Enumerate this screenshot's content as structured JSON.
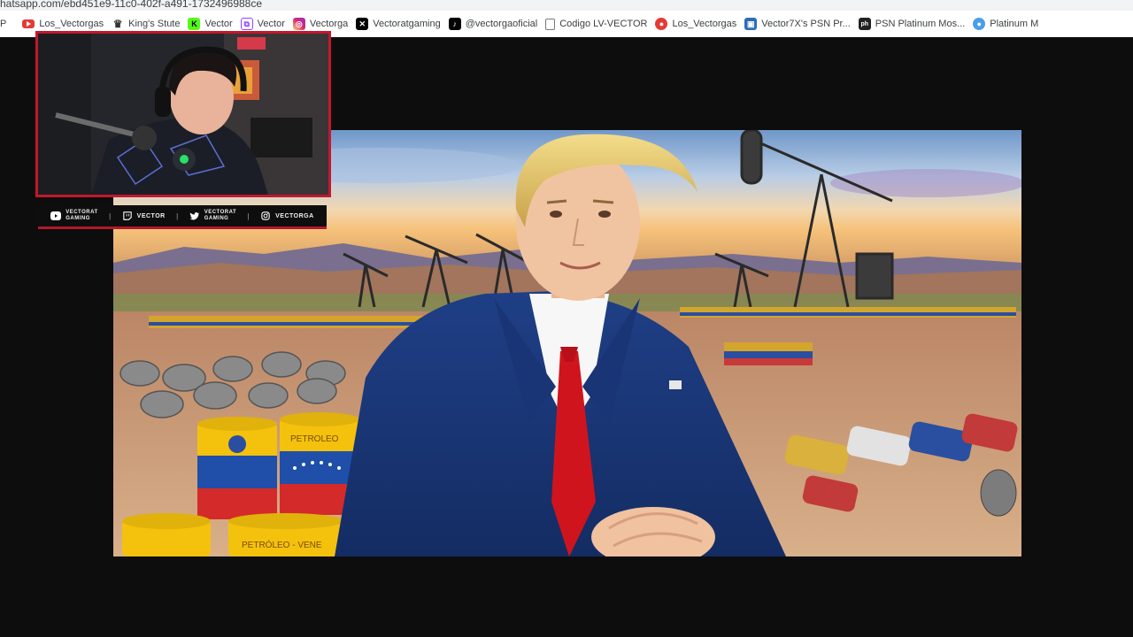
{
  "browser": {
    "url_fragment": "hatsapp.com/ebd451e9-11c0-402f-a491-1732496988ce",
    "bookmarks": [
      {
        "label": "P",
        "icon": "page-edge"
      },
      {
        "label": "Los_Vectorgas",
        "icon": "youtube-icon"
      },
      {
        "label": "King's Stute",
        "icon": "crown-icon"
      },
      {
        "label": "Vector",
        "icon": "kick-icon"
      },
      {
        "label": "Vector",
        "icon": "twitch-icon"
      },
      {
        "label": "Vectorga",
        "icon": "instagram-icon"
      },
      {
        "label": "Vectoratgaming",
        "icon": "x-icon"
      },
      {
        "label": "@vectorgaoficial",
        "icon": "tiktok-icon"
      },
      {
        "label": "Codigo LV-VECTOR",
        "icon": "page-icon"
      },
      {
        "label": "Los_Vectorgas",
        "icon": "red-circle-icon"
      },
      {
        "label": "Vector7X's PSN Pr...",
        "icon": "psn-icon"
      },
      {
        "label": "PSN Platinum Mos...",
        "icon": "ph-icon"
      },
      {
        "label": "Platinum M",
        "icon": "blue-circle-icon"
      }
    ]
  },
  "overlay": {
    "socials": [
      {
        "line1": "VECTORAT",
        "line2": "GAMING",
        "icon": "youtube-icon"
      },
      {
        "label": "VECTOR",
        "icon": "twitch-icon"
      },
      {
        "line1": "VECTORAT",
        "line2": "GAMING",
        "icon": "twitter-icon"
      },
      {
        "label": "VECTORGA",
        "icon": "instagram-icon"
      }
    ],
    "separator": "|"
  },
  "image": {
    "barrel_text": "PETROLEO",
    "barrel_text_2": "PETRÓLEO - VENE"
  },
  "colors": {
    "overlay_red": "#c2172c",
    "venezuela_yellow": "#f4c20d",
    "venezuela_blue": "#1f4fa8",
    "venezuela_red": "#d42a2a"
  }
}
